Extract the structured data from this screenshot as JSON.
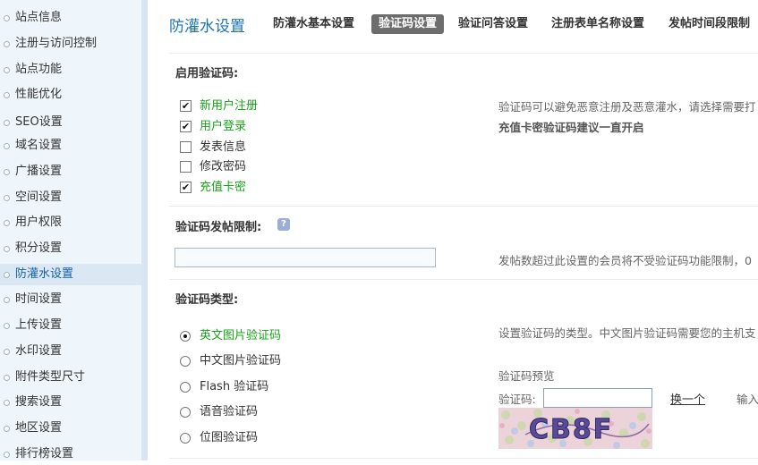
{
  "sidebar": {
    "items": [
      {
        "label": "站点信息"
      },
      {
        "label": "注册与访问控制"
      },
      {
        "label": "站点功能"
      },
      {
        "label": "性能优化"
      },
      {
        "label": "SEO设置"
      },
      {
        "label": "域名设置"
      },
      {
        "label": "广播设置"
      },
      {
        "label": "空间设置"
      },
      {
        "label": "用户权限"
      },
      {
        "label": "积分设置"
      },
      {
        "label": "防灌水设置"
      },
      {
        "label": "时间设置"
      },
      {
        "label": "上传设置"
      },
      {
        "label": "水印设置"
      },
      {
        "label": "附件类型尺寸"
      },
      {
        "label": "搜索设置"
      },
      {
        "label": "地区设置"
      },
      {
        "label": "排行榜设置"
      }
    ],
    "active_index": 10
  },
  "header": {
    "title": "防灌水设置",
    "tabs": [
      {
        "label": "防灌水基本设置"
      },
      {
        "label": "验证码设置"
      },
      {
        "label": "验证问答设置"
      },
      {
        "label": "注册表单名称设置"
      },
      {
        "label": "发帖时间段限制"
      }
    ],
    "active_tab": 1
  },
  "captcha_enable": {
    "title": "启用验证码:",
    "options": [
      {
        "label": "新用户注册",
        "checked": true
      },
      {
        "label": "用户登录",
        "checked": true
      },
      {
        "label": "发表信息",
        "checked": false
      },
      {
        "label": "修改密码",
        "checked": false
      },
      {
        "label": "充值卡密",
        "checked": true
      }
    ],
    "help_line1": "验证码可以避免恶意注册及恶意灌水，请选择需要打",
    "help_line2": "充值卡密验证码建议一直开启"
  },
  "post_limit": {
    "title": "验证码发帖限制:",
    "help_icon": "?",
    "value": "",
    "help": "发帖数超过此设置的会员将不受验证码功能限制，0"
  },
  "captcha_type": {
    "title": "验证码类型:",
    "options": [
      {
        "label": "英文图片验证码",
        "selected": true
      },
      {
        "label": "中文图片验证码",
        "selected": false
      },
      {
        "label": "Flash 验证码",
        "selected": false
      },
      {
        "label": "语音验证码",
        "selected": false
      },
      {
        "label": "位图验证码",
        "selected": false
      }
    ],
    "help": "设置验证码的类型。中文图片验证码需要您的主机支",
    "preview_title": "验证码预览",
    "field_label": "验证码:",
    "refresh_label": "换一个",
    "input_hint": "输入",
    "captcha_text": "CB8F"
  },
  "colors": {
    "accent": "#1a73b8",
    "active_tab_bg": "#6d6d6d",
    "checked_text": "#18a318",
    "sidebar_bg": "#eef5fb"
  }
}
